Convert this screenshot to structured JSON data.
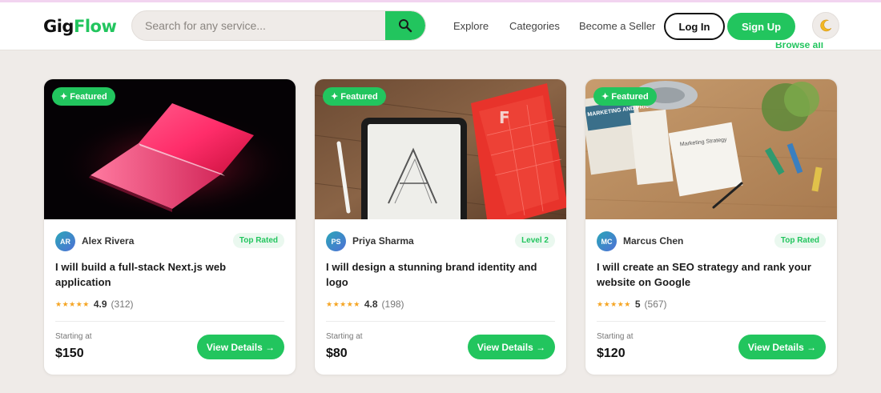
{
  "brand": {
    "logo_part1": "Gig",
    "logo_part2": "Flow",
    "accent": "#22c55e"
  },
  "search": {
    "placeholder": "Search for any service...",
    "icon": "search-icon"
  },
  "nav": {
    "explore": "Explore",
    "categories": "Categories",
    "become_seller": "Become a Seller"
  },
  "auth": {
    "login": "Log In",
    "signup": "Sign Up"
  },
  "theme": {
    "icon": "moon-icon"
  },
  "section": {
    "browse_all": "Browse all"
  },
  "cards": [
    {
      "featured": "✦ Featured",
      "initials": "AR",
      "seller": "Alex Rivera",
      "badge": "Top Rated",
      "title": "I will build a full-stack Next.js web application",
      "stars": "★★★★★",
      "rating": "4.9",
      "reviews": "(312)",
      "starting_label": "Starting at",
      "price": "$150",
      "cta": "View Details →"
    },
    {
      "featured": "✦ Featured",
      "initials": "PS",
      "seller": "Priya Sharma",
      "badge": "Level 2",
      "title": "I will design a stunning brand identity and logo",
      "stars": "★★★★★",
      "rating": "4.8",
      "reviews": "(198)",
      "starting_label": "Starting at",
      "price": "$80",
      "cta": "View Details →"
    },
    {
      "featured": "✦ Featured",
      "initials": "MC",
      "seller": "Marcus Chen",
      "badge": "Top Rated",
      "title": "I will create an SEO strategy and rank your website on Google",
      "stars": "★★★★★",
      "rating": "5",
      "reviews": "(567)",
      "starting_label": "Starting at",
      "price": "$120",
      "cta": "View Details →",
      "image_text": [
        "Marketing Strategy",
        "MARKETING AND PRICING"
      ]
    }
  ]
}
